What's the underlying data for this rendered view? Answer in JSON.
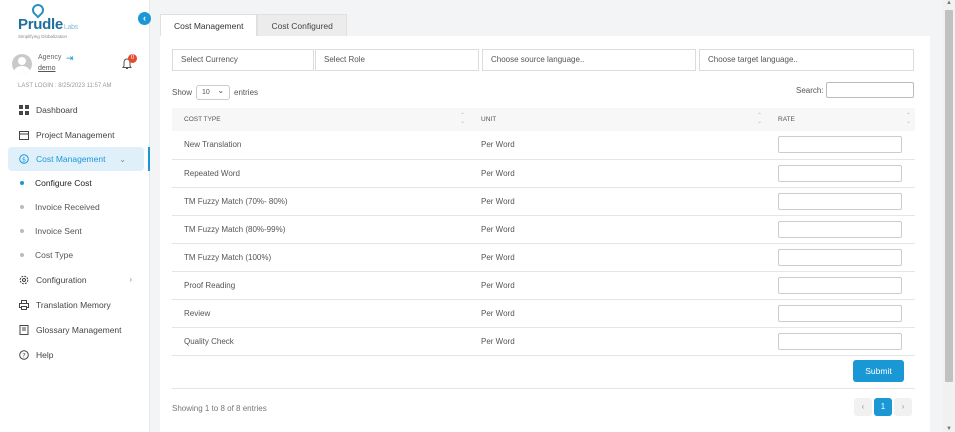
{
  "brand": {
    "name": "Prudle",
    "suffix": "Labs",
    "tagline": "Simplifying Globalization"
  },
  "user": {
    "role": "Agency",
    "name": "demo",
    "notifications": "0",
    "last_login": "LAST LOGIN : 8/25/2023 11:57 AM"
  },
  "sidebar": {
    "items": [
      {
        "label": "Dashboard",
        "icon": "dashboard-icon"
      },
      {
        "label": "Project Management",
        "icon": "calendar-icon"
      },
      {
        "label": "Cost Management",
        "icon": "dollar-circle-icon",
        "active": true
      },
      {
        "label": "Configuration",
        "icon": "settings-icon"
      },
      {
        "label": "Translation Memory",
        "icon": "printer-icon"
      },
      {
        "label": "Glossary Management",
        "icon": "book-icon"
      },
      {
        "label": "Help",
        "icon": "help-circle-icon"
      }
    ],
    "sub_items": [
      "Configure Cost",
      "Invoice Received",
      "Invoice Sent",
      "Cost Type"
    ]
  },
  "tabs": [
    "Cost Management",
    "Cost Configured"
  ],
  "filters": {
    "currency": "Select Currency",
    "role": "Select Role",
    "source": "Choose source language..",
    "target": "Choose target language.."
  },
  "table_controls": {
    "show": "Show",
    "entries_value": "10",
    "entries": "entries",
    "search": "Search:"
  },
  "table": {
    "headers": [
      "COST TYPE",
      "UNIT",
      "RATE"
    ],
    "rows": [
      {
        "cost_type": "New Translation",
        "unit": "Per Word"
      },
      {
        "cost_type": "Repeated Word",
        "unit": "Per Word"
      },
      {
        "cost_type": "TM Fuzzy Match (70%- 80%)",
        "unit": "Per Word"
      },
      {
        "cost_type": "TM Fuzzy Match (80%-99%)",
        "unit": "Per Word"
      },
      {
        "cost_type": "TM Fuzzy Match (100%)",
        "unit": "Per Word"
      },
      {
        "cost_type": "Proof Reading",
        "unit": "Per Word"
      },
      {
        "cost_type": "Review",
        "unit": "Per Word"
      },
      {
        "cost_type": "Quality Check",
        "unit": "Per Word"
      }
    ]
  },
  "submit_label": "Submit",
  "footer": {
    "info": "Showing 1 to 8 of 8 entries",
    "page": "1",
    "prev": "‹",
    "next": "›"
  },
  "colors": {
    "accent": "#1a98d5",
    "badge": "#e64a2e"
  }
}
